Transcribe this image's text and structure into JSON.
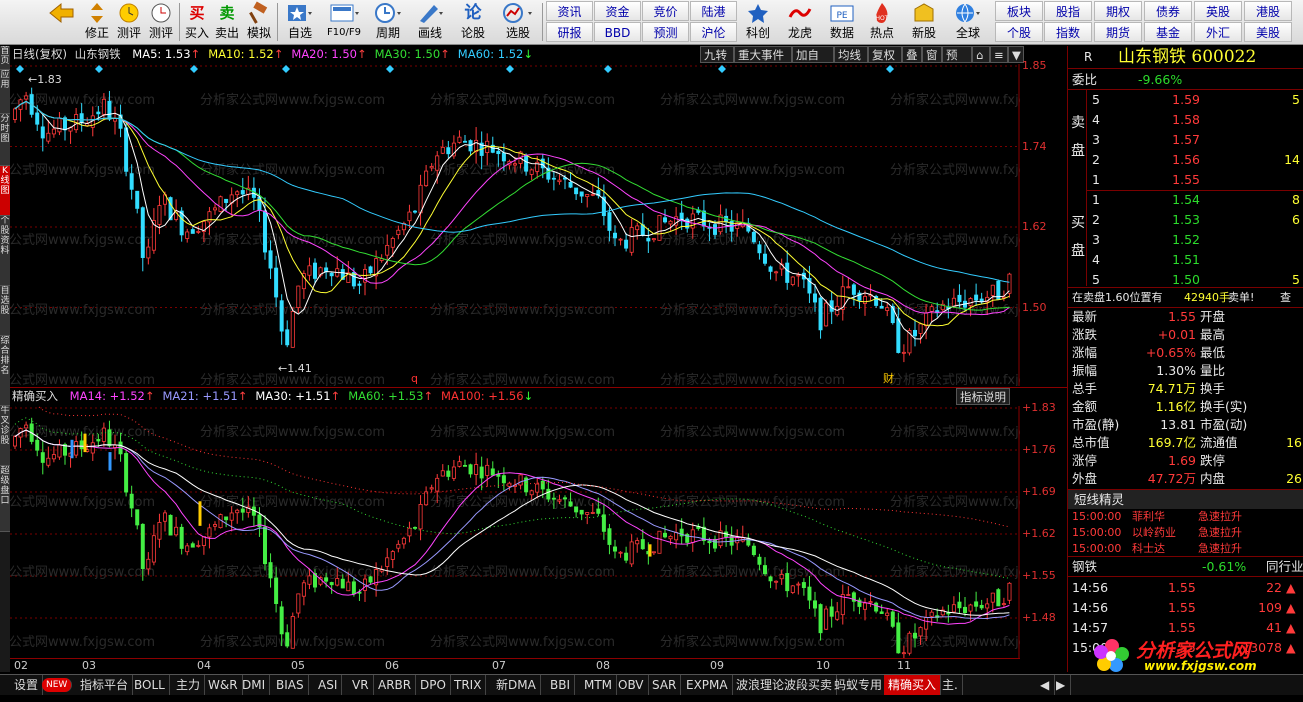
{
  "toolbar": {
    "buttons": [
      {
        "label": "",
        "icon": "back-arrow-icon"
      },
      {
        "label": "修正",
        "icon": "up-down-arrow-icon"
      },
      {
        "label": "测评",
        "icon": "alarm-clock-icon"
      },
      {
        "label": "买入",
        "icon": "buy-icon"
      },
      {
        "label": "卖出",
        "icon": "sell-icon"
      },
      {
        "label": "模拟",
        "icon": "gavel-icon"
      },
      {
        "label": "自选",
        "icon": "star-icon"
      },
      {
        "label": "F10/F9",
        "icon": "report-icon"
      },
      {
        "label": "周期",
        "icon": "clock-icon"
      },
      {
        "label": "画线",
        "icon": "pen-icon"
      },
      {
        "label": "论股",
        "icon": "chat-icon"
      },
      {
        "label": "选股",
        "icon": "stock-picker-icon"
      }
    ],
    "buy_glyph": "买",
    "sell_glyph": "卖",
    "forum_glyph": "论",
    "quick_row1": [
      "资讯",
      "资金",
      "竞价",
      "陆港"
    ],
    "quick_row2": [
      "研报",
      "BBD",
      "预测",
      "沪伦"
    ],
    "big_buttons": [
      {
        "label": "科创",
        "icon": "kechuang-icon"
      },
      {
        "label": "龙虎",
        "icon": "dragon-tiger-icon"
      },
      {
        "label": "数据",
        "icon": "pe-data-icon",
        "glyph": "PE"
      },
      {
        "label": "热点",
        "icon": "hot-spot-icon",
        "glyph": "HOT"
      },
      {
        "label": "新股",
        "icon": "new-stock-icon"
      },
      {
        "label": "全球",
        "icon": "globe-icon"
      }
    ],
    "right_row1": [
      "板块",
      "股指",
      "期权",
      "债券",
      "英股",
      "港股"
    ],
    "right_row2": [
      "个股",
      "指数",
      "期货",
      "基金",
      "外汇",
      "美股"
    ]
  },
  "left_tabs": [
    "首页",
    "应用",
    "分时图",
    "K线图",
    "个股资料",
    "自选股",
    "综合排名",
    "牛叉诊股",
    "超级盘口"
  ],
  "k_chart": {
    "period": "日线(复权)",
    "stock_name": "山东钢铁",
    "ma": [
      {
        "label": "MA5: 1.53",
        "color": "#ffffff"
      },
      {
        "label": "MA10: 1.52",
        "color": "#ffff33"
      },
      {
        "label": "MA20: 1.50",
        "color": "#ff44ff"
      },
      {
        "label": "MA30: 1.50",
        "color": "#33dd33"
      },
      {
        "label": "MA60: 1.52",
        "color": "#33ccff"
      }
    ],
    "ma_arrows": [
      "↑",
      "↑",
      "↑",
      "↑",
      "↓"
    ],
    "buttons": [
      "九转",
      "重大事件",
      "加自选",
      "均线",
      "复权",
      "叠",
      "窗",
      "预测",
      "⌂",
      "≡",
      "▼"
    ],
    "y_ticks": [
      "1.85",
      "1.74",
      "1.62",
      "1.50"
    ],
    "high_label": "1.83",
    "low_label": "1.41",
    "marker_q": "q",
    "marker_cai": "财"
  },
  "ind_chart": {
    "name": "精确买入",
    "ma": [
      {
        "label": "MA14: +1.52",
        "color": "#ff44ff"
      },
      {
        "label": "MA21: +1.51",
        "color": "#9999ff"
      },
      {
        "label": "MA30: +1.51",
        "color": "#ffffff"
      },
      {
        "label": "MA60: +1.53",
        "color": "#33dd33"
      },
      {
        "label": "MA100: +1.56",
        "color": "#ff3333"
      }
    ],
    "ma_arrows": [
      "↑",
      "↑",
      "↑",
      "↑",
      "↓"
    ],
    "help_button": "指标说明",
    "y_ticks": [
      "+1.83",
      "+1.76",
      "+1.69",
      "+1.62",
      "+1.55",
      "+1.48"
    ]
  },
  "x_months": [
    "02",
    "03",
    "04",
    "05",
    "06",
    "07",
    "08",
    "09",
    "10",
    "11"
  ],
  "watermark": "分析家公式网www.fxjgsw.com",
  "quote": {
    "stock_title": "山东钢铁 600022",
    "r_flag": "R",
    "weibi_label": "委比",
    "weibi_value": "-9.66%",
    "sell_label": [
      "卖",
      "盘"
    ],
    "buy_label": [
      "买",
      "盘"
    ],
    "sell": [
      {
        "n": "5",
        "price": "1.59",
        "vol": "5"
      },
      {
        "n": "4",
        "price": "1.58",
        "vol": ""
      },
      {
        "n": "3",
        "price": "1.57",
        "vol": ""
      },
      {
        "n": "2",
        "price": "1.56",
        "vol": "14"
      },
      {
        "n": "1",
        "price": "1.55",
        "vol": ""
      }
    ],
    "buy": [
      {
        "n": "1",
        "price": "1.54",
        "vol": "8"
      },
      {
        "n": "2",
        "price": "1.53",
        "vol": "6"
      },
      {
        "n": "3",
        "price": "1.52",
        "vol": ""
      },
      {
        "n": "4",
        "price": "1.51",
        "vol": ""
      },
      {
        "n": "5",
        "price": "1.50",
        "vol": "5"
      }
    ],
    "notice_left": "在卖盘1.60位置有",
    "notice_vol": "42940手",
    "notice_right": "卖单!",
    "notice_btn": "查",
    "stats": [
      {
        "l1": "最新",
        "v1": "1.55",
        "c1": "red",
        "l2": "开盘",
        "v2": ""
      },
      {
        "l1": "涨跌",
        "v1": "+0.01",
        "c1": "red",
        "l2": "最高",
        "v2": ""
      },
      {
        "l1": "涨幅",
        "v1": "+0.65%",
        "c1": "red",
        "l2": "最低",
        "v2": ""
      },
      {
        "l1": "振幅",
        "v1": "1.30%",
        "c1": "white",
        "l2": "量比",
        "v2": ""
      },
      {
        "l1": "总手",
        "v1": "74.71万",
        "c1": "yellow",
        "l2": "换手",
        "v2": ""
      },
      {
        "l1": "金额",
        "v1": "1.16亿",
        "c1": "yellow",
        "l2": "换手(实)",
        "v2": ""
      },
      {
        "l1": "市盈(静)",
        "v1": "13.81",
        "c1": "white",
        "l2": "市盈(动)",
        "v2": ""
      },
      {
        "l1": "总市值",
        "v1": "169.7亿",
        "c1": "yellow",
        "l2": "流通值",
        "v2": "16"
      },
      {
        "l1": "涨停",
        "v1": "1.69",
        "c1": "red",
        "l2": "跌停",
        "v2": ""
      },
      {
        "l1": "外盘",
        "v1": "47.72万",
        "c1": "red",
        "l2": "内盘",
        "v2": "26"
      }
    ],
    "elf_title": "短线精灵",
    "elf": [
      {
        "time": "15:00:00",
        "name": "菲利华",
        "event": "急速拉升"
      },
      {
        "time": "15:00:00",
        "name": "以岭药业",
        "event": "急速拉升"
      },
      {
        "time": "15:00:00",
        "name": "科士达",
        "event": "急速拉升"
      }
    ],
    "sector_name": "钢铁",
    "sector_pct": "-0.61%",
    "sector_btn": "同行业",
    "ticks": [
      {
        "time": "14:56",
        "price": "1.55",
        "vol": "22"
      },
      {
        "time": "14:56",
        "price": "1.55",
        "vol": "109"
      },
      {
        "time": "14:57",
        "price": "1.55",
        "vol": "41"
      },
      {
        "time": "15:00",
        "price": "1.55",
        "vol": "13078"
      }
    ],
    "logo_text": "分析家公式网",
    "logo_url": "www.fxjgsw.com"
  },
  "bottom_tabs": [
    "设置",
    "NEW",
    "指标平台",
    "BOLL",
    "主力",
    "W&R",
    "DMI",
    "BIAS",
    "ASI",
    "VR",
    "ARBR",
    "DPO",
    "TRIX",
    "新DMA",
    "BBI",
    "MTM",
    "OBV",
    "SAR",
    "EXPMA",
    "波浪理论波段买卖",
    "蚂蚁专用",
    "精确买入",
    "主."
  ],
  "bottom_active": "精确买入",
  "colors": {
    "up": "#ff3a3a",
    "down": "#33ddff",
    "ind_up": "#ff3a3a",
    "ind_down": "#44ee44",
    "border": "#8b0000"
  }
}
